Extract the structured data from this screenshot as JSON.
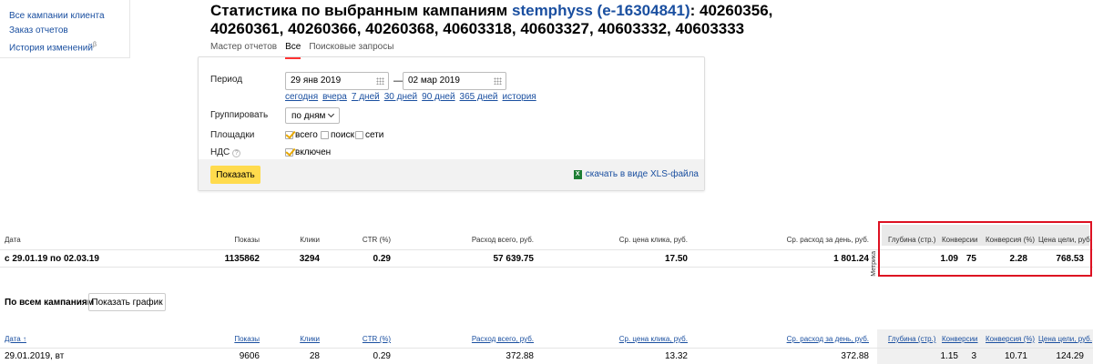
{
  "nav": {
    "items": [
      "Все кампании клиента",
      "Заказ отчетов",
      "История изменений"
    ],
    "beta": "β"
  },
  "title": {
    "prefix": "Статистика по выбранным кампаниям",
    "login": "stemphyss (e-16304841)",
    "campaigns": ": 40260356, 40260361, 40260366, 40260368, 40603318, 40603327, 40603332, 40603333"
  },
  "tabs": [
    {
      "label": "Мастер отчетов",
      "active": false
    },
    {
      "label": "Все",
      "active": true
    },
    {
      "label": "Поисковые запросы",
      "active": false
    }
  ],
  "filters": {
    "period_label": "Период",
    "date_from": "29 янв 2019",
    "date_sep": "—",
    "date_to": "02 мар 2019",
    "quick_links": [
      "сегодня",
      "вчера",
      "7 дней",
      "30 дней",
      "90 дней",
      "365 дней",
      "история"
    ],
    "group_label": "Группировать",
    "group_value": "по дням",
    "platforms_label": "Площадки",
    "platforms": [
      {
        "label": "всего",
        "checked": true
      },
      {
        "label": "поиск",
        "checked": false
      },
      {
        "label": "сети",
        "checked": false
      }
    ],
    "vat_label": "НДС",
    "vat_help": "?",
    "vat_option": {
      "label": "включен",
      "checked": true
    },
    "show_button": "Показать",
    "xls_link": "скачать в виде XLS-файла",
    "xls_icon": "X"
  },
  "summary": {
    "headers": [
      "Дата",
      "Показы",
      "Клики",
      "CTR (%)",
      "Расход всего, руб.",
      "Ср. цена клика, руб.",
      "Ср. расход за день, руб.",
      "Глубина (стр.)",
      "Конверсии",
      "Конверсия (%)",
      "Цена цели, руб."
    ],
    "vertical_label": "Метрика",
    "row": [
      "с 29.01.19 по 02.03.19",
      "1135862",
      "3294",
      "0.29",
      "57 639.75",
      "17.50",
      "1 801.24",
      "1.09",
      "75",
      "2.28",
      "768.53"
    ]
  },
  "all_campaigns": {
    "label": "По всем кампаниям",
    "graph_button": "Показать график"
  },
  "detail": {
    "headers": [
      "Дата ↑",
      "Показы",
      "Клики",
      "CTR (%)",
      "Расход всего, руб.",
      "Ср. цена клика, руб.",
      "Ср. расход за день, руб.",
      "Глубина (стр.)",
      "Конверсии",
      "Конверсия (%)",
      "Цена цели, руб."
    ],
    "rows": [
      [
        "29.01.2019, вт",
        "9606",
        "28",
        "0.29",
        "372.88",
        "13.32",
        "372.88",
        "1.15",
        "3",
        "10.71",
        "124.29"
      ]
    ]
  },
  "colors": {
    "link": "#1a4fa0",
    "accent_button": "#ffdb4d",
    "highlight_box": "#dd1122",
    "active_tab": "#ff3333",
    "checkbox_mark": "#e8a800"
  }
}
